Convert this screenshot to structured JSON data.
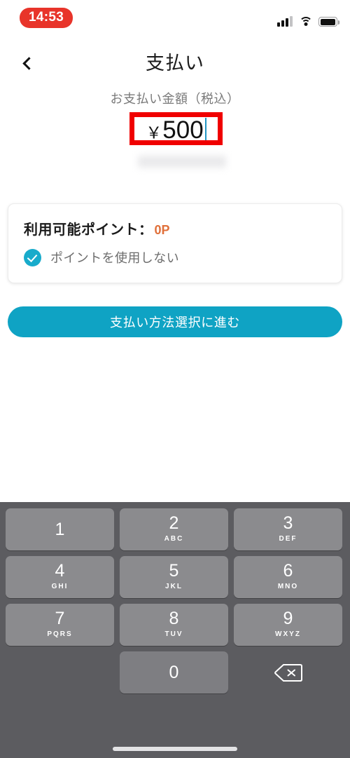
{
  "status_bar": {
    "time": "14:53",
    "recording_indicator": true,
    "signal_icon": "cellular-signal-icon",
    "wifi_icon": "wifi-icon",
    "battery_icon": "battery-icon"
  },
  "nav": {
    "back_icon": "back-chevron-icon",
    "title": "支払い"
  },
  "amount": {
    "label": "お支払い金額（税込）",
    "currency_symbol": "￥",
    "value": "500",
    "annotation_color": "#F00000",
    "caret_visible": true,
    "redacted_hint": ""
  },
  "points_card": {
    "available_label": "利用可能ポイント：",
    "available_value": "0P",
    "available_value_color": "#E0703A",
    "option_checked": true,
    "option_label": "ポイントを使用しない",
    "check_color": "#18ABCB"
  },
  "cta": {
    "label": "支払い方法選択に進む",
    "color": "#0FA3C4"
  },
  "keypad": {
    "background": "#5C5C60",
    "key_color": "#8B8B8E",
    "keys": [
      {
        "num": "1",
        "sub": ""
      },
      {
        "num": "2",
        "sub": "ABC"
      },
      {
        "num": "3",
        "sub": "DEF"
      },
      {
        "num": "4",
        "sub": "GHI"
      },
      {
        "num": "5",
        "sub": "JKL"
      },
      {
        "num": "6",
        "sub": "MNO"
      },
      {
        "num": "7",
        "sub": "PQRS"
      },
      {
        "num": "8",
        "sub": "TUV"
      },
      {
        "num": "9",
        "sub": "WXYZ"
      },
      {
        "num": "",
        "sub": ""
      },
      {
        "num": "0",
        "sub": ""
      },
      {
        "num": "delete-icon",
        "sub": ""
      }
    ]
  },
  "home_indicator": true
}
